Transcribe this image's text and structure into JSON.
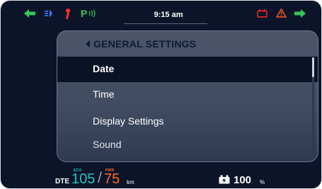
{
  "topbar": {
    "time": "9:15 am",
    "icons": [
      "left-turn-icon",
      "headlight-icon",
      "side-stand-icon",
      "parking-icon",
      "battery-warning-icon",
      "warning-icon",
      "right-turn-icon"
    ],
    "colors": {
      "green": "#35c759",
      "blue": "#3b7bff",
      "red": "#ff2c2c",
      "orange": "#ff5a1f"
    }
  },
  "menu": {
    "title": "GENERAL SETTINGS",
    "items": [
      {
        "label": "Date",
        "selected": true
      },
      {
        "label": "Time",
        "selected": false
      },
      {
        "label": "Display Settings",
        "selected": false
      },
      {
        "label": "Sound",
        "selected": false
      }
    ]
  },
  "status": {
    "dte_label": "DTE",
    "eco_label": "ECO",
    "eco_value": "105",
    "separator": "/",
    "pwr_label": "PWR",
    "pwr_value": "75",
    "unit": "km",
    "battery_percent": "100",
    "percent_sign": "%"
  }
}
